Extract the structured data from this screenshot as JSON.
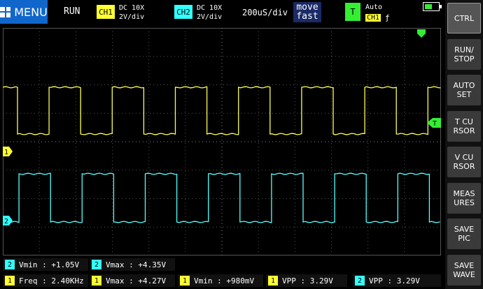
{
  "menu": {
    "label": "MENU",
    "icon": "grid-icon"
  },
  "status": {
    "run_state": "RUN"
  },
  "channels": [
    {
      "badge": "CH1",
      "coupling": "DC 10X",
      "scale": "2V/div",
      "color": "#ffff33"
    },
    {
      "badge": "CH2",
      "coupling": "DC 10X",
      "scale": "2V/div",
      "color": "#33ffff"
    }
  ],
  "timebase": "200uS/div",
  "move": {
    "line1": "move",
    "line2": "fast"
  },
  "trigger": {
    "badge": "T",
    "mode": "Auto",
    "source": "CH1",
    "edge": "ƒ",
    "color": "#33ee33"
  },
  "battery": {
    "level": 0.6
  },
  "sidebar": [
    {
      "label": "CTRL"
    },
    {
      "label": "RUN/\nSTOP"
    },
    {
      "label": "AUTO\nSET"
    },
    {
      "label": "T CU\nRSOR"
    },
    {
      "label": "V CU\nRSOR"
    },
    {
      "label": "MEAS\nURES"
    },
    {
      "label": "SAVE\nPIC"
    },
    {
      "label": "SAVE\nWAVE"
    }
  ],
  "markers": {
    "ch1": "1",
    "ch2": "2",
    "trigger_level": "T"
  },
  "measures": [
    {
      "ch": "2",
      "label": "Vmin",
      "value": "+1.05V"
    },
    {
      "ch": "2",
      "label": "Vmax",
      "value": "+4.35V"
    },
    {
      "ch": "1",
      "label": "Freq",
      "value": "2.40KHz"
    },
    {
      "ch": "1",
      "label": "Vmax",
      "value": "+4.27V"
    },
    {
      "ch": "1",
      "label": "Vmin",
      "value": "+980mV"
    },
    {
      "ch": "1",
      "label": "VPP",
      "value": "3.29V"
    },
    {
      "ch": "2",
      "label": "VPP",
      "value": "3.29V"
    }
  ]
}
